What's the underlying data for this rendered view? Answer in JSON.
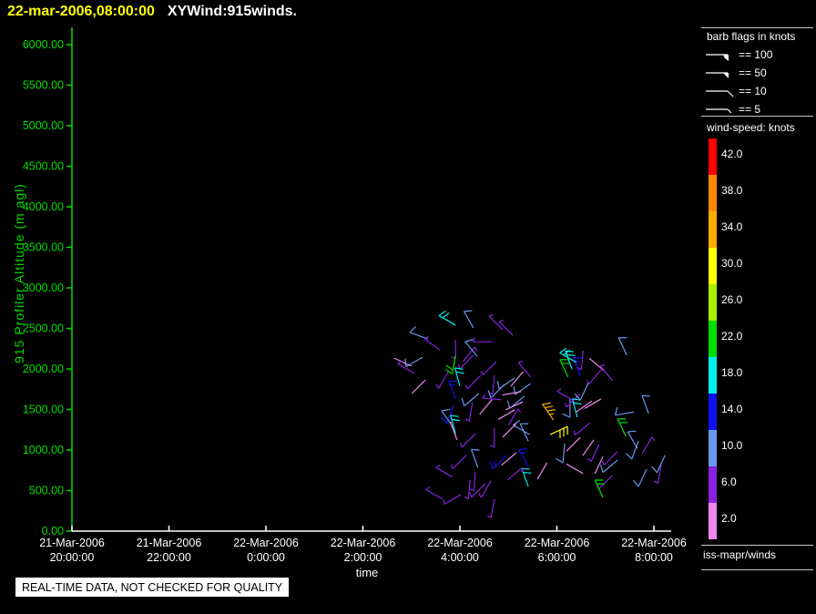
{
  "window": {
    "title_datetime": "22-mar-2006,08:00:00",
    "title_plot": "XYWind:915winds."
  },
  "palette": {
    "background": "#000000",
    "y_axis": "#00dd00",
    "x_axis": "#ffffff",
    "title_datetime": "#ffff00",
    "title_plot": "#ffffff",
    "separator_line": "#c8c8c8"
  },
  "y_axis": {
    "label": "915 Profiler Altitude (m agl)",
    "tick_labels": [
      "6000.00",
      "5500.00",
      "5000.00",
      "4500.00",
      "4000.00",
      "3500.00",
      "3000.00",
      "2500.00",
      "2000.00",
      "1500.00",
      "1000.00",
      "500.00",
      "0.00"
    ],
    "min": 0,
    "max": 6000
  },
  "x_axis": {
    "label": "time",
    "tick_dates": [
      "21-Mar-2006",
      "21-Mar-2006",
      "22-Mar-2006",
      "22-Mar-2006",
      "22-Mar-2006",
      "22-Mar-2006",
      "22-Mar-2006"
    ],
    "tick_times": [
      "20:00:00",
      "22:00:00",
      "0:00:00",
      "2:00:00",
      "4:00:00",
      "6:00:00",
      "8:00:00"
    ]
  },
  "barb_legend": {
    "title": "barb flags in knots",
    "items": [
      {
        "label": "== 100",
        "knots": 100
      },
      {
        "label": "== 50",
        "knots": 50
      },
      {
        "label": "== 10",
        "knots": 10
      },
      {
        "label": "== 5",
        "knots": 5
      }
    ]
  },
  "color_scale": {
    "title": "wind-speed: knots",
    "entries": [
      {
        "label": "42.0",
        "value": 42,
        "color": "#ff0000"
      },
      {
        "label": "38.0",
        "value": 38,
        "color": "#ff8800"
      },
      {
        "label": "34.0",
        "value": 34,
        "color": "#ffaa00"
      },
      {
        "label": "30.0",
        "value": 30,
        "color": "#ffff00"
      },
      {
        "label": "26.0",
        "value": 26,
        "color": "#aaee00"
      },
      {
        "label": "22.0",
        "value": 22,
        "color": "#00dd00"
      },
      {
        "label": "18.0",
        "value": 18,
        "color": "#00eeee"
      },
      {
        "label": "14.0",
        "value": 14,
        "color": "#1111ee"
      },
      {
        "label": "10.0",
        "value": 10,
        "color": "#6699ee"
      },
      {
        "label": "6.0",
        "value": 6,
        "color": "#8822dd"
      },
      {
        "label": "2.0",
        "value": 2,
        "color": "#ee88ee"
      }
    ]
  },
  "footer": {
    "source_label": "iss-mapr/winds",
    "quality_banner": "REAL-TIME DATA, NOT CHECKED FOR QUALITY"
  },
  "chart_data": {
    "type": "scatter",
    "marker": "wind-barb",
    "title": "XYWind:915winds.",
    "xlabel": "time",
    "ylabel": "915 Profiler Altitude (m agl)",
    "time_origin": "21-Mar-2006 20:00:00",
    "xlim_hours": [
      0,
      12.35
    ],
    "ylim_m": [
      0,
      6000
    ],
    "barb_columns": [
      "hours_since_origin",
      "altitude_m",
      "staff_angle_deg",
      "speed_knots"
    ],
    "barbs": [
      [
        7.91,
        2540,
        210,
        18
      ],
      [
        8.28,
        2505,
        240,
        10
      ],
      [
        7.91,
        2360,
        90,
        6
      ],
      [
        8.88,
        2485,
        225,
        6
      ],
      [
        8.66,
        2335,
        180,
        6
      ],
      [
        7.34,
        2370,
        200,
        10
      ],
      [
        7.59,
        2235,
        215,
        6
      ],
      [
        7.91,
        2170,
        100,
        22
      ],
      [
        7.23,
        2145,
        150,
        10
      ],
      [
        7.0,
        2035,
        205,
        2
      ],
      [
        7.06,
        1945,
        210,
        6
      ],
      [
        7.76,
        1965,
        120,
        6
      ],
      [
        8.06,
        2090,
        310,
        6
      ],
      [
        8.28,
        2170,
        135,
        6
      ],
      [
        8.36,
        2155,
        230,
        10
      ],
      [
        8.75,
        2090,
        135,
        6
      ],
      [
        8.43,
        1920,
        135,
        6
      ],
      [
        8.71,
        1920,
        95,
        6
      ],
      [
        8.92,
        1810,
        135,
        10
      ],
      [
        9.05,
        1785,
        310,
        2
      ],
      [
        7.91,
        1630,
        250,
        14
      ],
      [
        7.87,
        1550,
        110,
        14
      ],
      [
        8.0,
        1785,
        255,
        18
      ],
      [
        8.26,
        1585,
        100,
        6
      ],
      [
        8.39,
        1695,
        140,
        10
      ],
      [
        8.66,
        1620,
        130,
        2
      ],
      [
        8.86,
        1620,
        185,
        6
      ],
      [
        9.33,
        1665,
        140,
        10
      ],
      [
        9.3,
        1595,
        155,
        2
      ],
      [
        9.46,
        1900,
        230,
        6
      ],
      [
        9.46,
        1820,
        145,
        10
      ],
      [
        10.31,
        2000,
        250,
        18
      ],
      [
        10.23,
        1900,
        245,
        22
      ],
      [
        10.48,
        1920,
        250,
        14
      ],
      [
        10.97,
        1980,
        220,
        2
      ],
      [
        11.15,
        1855,
        230,
        6
      ],
      [
        9.13,
        1890,
        145,
        10
      ],
      [
        9.26,
        1720,
        170,
        2
      ],
      [
        9.13,
        1495,
        150,
        2
      ],
      [
        10.27,
        1640,
        90,
        10
      ],
      [
        10.48,
        1695,
        135,
        6
      ],
      [
        10.91,
        1630,
        150,
        2
      ],
      [
        9.93,
        1370,
        235,
        34
      ],
      [
        9.86,
        1190,
        335,
        30
      ],
      [
        10.42,
        1405,
        255,
        18
      ],
      [
        10.68,
        1335,
        140,
        6
      ],
      [
        9.44,
        1190,
        210,
        10
      ],
      [
        10.16,
        1080,
        95,
        10
      ],
      [
        10.76,
        1125,
        125,
        2
      ],
      [
        11.42,
        1170,
        245,
        22
      ],
      [
        11.68,
        1110,
        110,
        10
      ],
      [
        11.25,
        980,
        135,
        6
      ],
      [
        10.95,
        920,
        115,
        2
      ],
      [
        11.59,
        1470,
        170,
        10
      ],
      [
        11.89,
        1450,
        250,
        10
      ],
      [
        11.44,
        2170,
        245,
        10
      ],
      [
        10.4,
        2080,
        210,
        18
      ],
      [
        10.91,
        1990,
        130,
        6
      ],
      [
        10.65,
        1830,
        115,
        10
      ],
      [
        10.35,
        1605,
        210,
        6
      ],
      [
        10.72,
        1605,
        145,
        2
      ],
      [
        10.48,
        1155,
        135,
        2
      ],
      [
        10.87,
        1070,
        115,
        6
      ],
      [
        11.66,
        1020,
        240,
        10
      ],
      [
        11.76,
        955,
        300,
        6
      ],
      [
        11.25,
        875,
        140,
        10
      ],
      [
        10.54,
        710,
        210,
        2
      ],
      [
        11.14,
        685,
        135,
        6
      ],
      [
        10.95,
        415,
        245,
        22
      ],
      [
        11.85,
        765,
        115,
        10
      ],
      [
        12.15,
        820,
        100,
        6
      ],
      [
        7.85,
        1290,
        235,
        10
      ],
      [
        7.91,
        1200,
        255,
        18
      ],
      [
        7.94,
        1125,
        250,
        2
      ],
      [
        8.32,
        1200,
        135,
        6
      ],
      [
        8.71,
        1270,
        90,
        6
      ],
      [
        9.0,
        1305,
        300,
        6
      ],
      [
        9.16,
        1325,
        135,
        2
      ],
      [
        9.41,
        1110,
        245,
        10
      ],
      [
        8.37,
        785,
        250,
        10
      ],
      [
        8.96,
        935,
        135,
        14
      ],
      [
        9.16,
        965,
        140,
        2
      ],
      [
        9.41,
        800,
        240,
        14
      ],
      [
        9.41,
        550,
        250,
        18
      ],
      [
        9.6,
        640,
        300,
        2
      ],
      [
        8.13,
        935,
        135,
        6
      ],
      [
        8.32,
        730,
        95,
        6
      ],
      [
        7.85,
        665,
        210,
        6
      ],
      [
        8.52,
        585,
        135,
        6
      ],
      [
        8.02,
        450,
        150,
        6
      ],
      [
        8.71,
        395,
        100,
        6
      ],
      [
        8.21,
        630,
        95,
        6
      ],
      [
        8.64,
        620,
        120,
        6
      ],
      [
        8.98,
        630,
        320,
        6
      ],
      [
        7.64,
        395,
        210,
        6
      ],
      [
        7.29,
        1865,
        135,
        2
      ],
      [
        9.09,
        2415,
        225,
        6
      ],
      [
        10.54,
        2225,
        95,
        6
      ],
      [
        12.23,
        935,
        115,
        10
      ]
    ]
  }
}
